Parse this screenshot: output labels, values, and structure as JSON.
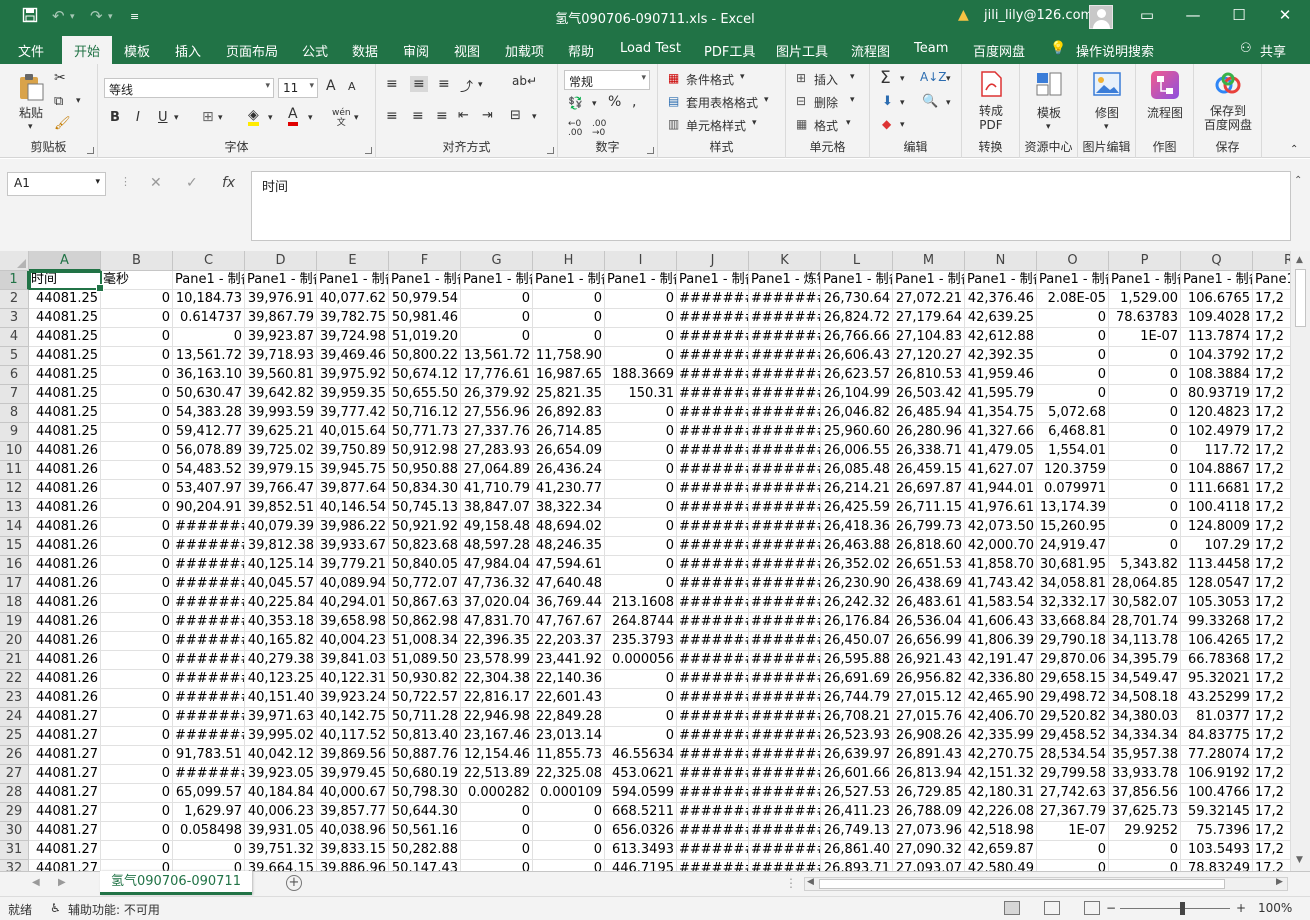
{
  "titlebar": {
    "title": "氢气090706-090711.xls  -  Excel",
    "user": "jili_lily@126.com"
  },
  "tabs": [
    "文件",
    "开始",
    "模板",
    "插入",
    "页面布局",
    "公式",
    "数据",
    "审阅",
    "视图",
    "加载项",
    "帮助",
    "Load Test",
    "PDF工具",
    "图片工具",
    "流程图",
    "Team",
    "百度网盘",
    "操作说明搜索",
    "共享"
  ],
  "ribbon": {
    "clipboard": {
      "paste": "粘贴",
      "label": "剪贴板"
    },
    "font": {
      "name": "等线",
      "size": "11",
      "grow": "A",
      "shrink": "A",
      "bold": "B",
      "italic": "I",
      "underline": "U",
      "wen": "wén",
      "label": "字体"
    },
    "align": {
      "label": "对齐方式"
    },
    "number": {
      "format": "常规",
      "percent": "%",
      "label": "数字"
    },
    "styles": {
      "cond": "条件格式",
      "table": "套用表格格式",
      "cell": "单元格样式",
      "label": "样式"
    },
    "cells": {
      "insert": "插入",
      "delete": "删除",
      "format": "格式",
      "label": "单元格"
    },
    "edit": {
      "label": "编辑"
    },
    "convert": {
      "btn1": "转成",
      "btn2": "PDF",
      "label": "转换"
    },
    "template": {
      "btn": "模板",
      "label": "资源中心"
    },
    "picture": {
      "btn": "修图",
      "label": "图片编辑"
    },
    "draw": {
      "btn": "流程图",
      "label": "作图"
    },
    "save": {
      "btn1": "保存到",
      "btn2": "百度网盘",
      "label": "保存"
    }
  },
  "formula": {
    "namebox": "A1",
    "fx": "fx",
    "content": "时间"
  },
  "columns": [
    "A",
    "B",
    "C",
    "D",
    "E",
    "F",
    "G",
    "H",
    "I",
    "J",
    "K",
    "L",
    "M",
    "N",
    "O",
    "P",
    "Q",
    "R"
  ],
  "rows": [
    [
      "时间",
      "毫秒",
      "Pane1 - 制备",
      "Pane1 - 制备",
      "Pane1 - 制备",
      "Pane1 - 制备",
      "Pane1 - 制备",
      "Pane1 - 制备",
      "Pane1 - 制备",
      "Pane1 - 制备",
      "Pane1 - 炼钢",
      "Pane1 - 制备",
      "Pane1 - 制备",
      "Pane1 - 制备",
      "Pane1 - 制备",
      "Pane1 - 制备",
      "Pane1 - 制备",
      "Pane1"
    ],
    [
      "44081.25",
      "0",
      "10,184.73",
      "39,976.91",
      "40,077.62",
      "50,979.54",
      "0",
      "0",
      "0",
      "#######",
      "#######",
      "26,730.64",
      "27,072.21",
      "42,376.46",
      "2.08E-05",
      "1,529.00",
      "106.6765",
      "17,2"
    ],
    [
      "44081.25",
      "0",
      "0.614737",
      "39,867.79",
      "39,782.75",
      "50,981.46",
      "0",
      "0",
      "0",
      "#######",
      "#######",
      "26,824.72",
      "27,179.64",
      "42,639.25",
      "0",
      "78.63783",
      "109.4028",
      "17,2"
    ],
    [
      "44081.25",
      "0",
      "0",
      "39,923.87",
      "39,724.98",
      "51,019.20",
      "0",
      "0",
      "0",
      "#######",
      "#######",
      "26,766.66",
      "27,104.83",
      "42,612.88",
      "0",
      "1E-07",
      "113.7874",
      "17,2"
    ],
    [
      "44081.25",
      "0",
      "13,561.72",
      "39,718.93",
      "39,469.46",
      "50,800.22",
      "13,561.72",
      "11,758.90",
      "0",
      "#######",
      "#######",
      "26,606.43",
      "27,120.27",
      "42,392.35",
      "0",
      "0",
      "104.3792",
      "17,2"
    ],
    [
      "44081.25",
      "0",
      "36,163.10",
      "39,560.81",
      "39,975.92",
      "50,674.12",
      "17,776.61",
      "16,987.65",
      "188.3669",
      "#######",
      "#######",
      "26,623.57",
      "26,810.53",
      "41,959.46",
      "0",
      "0",
      "108.3884",
      "17,2"
    ],
    [
      "44081.25",
      "0",
      "50,630.47",
      "39,642.82",
      "39,959.35",
      "50,655.50",
      "26,379.92",
      "25,821.35",
      "150.31",
      "#######",
      "#######",
      "26,104.99",
      "26,503.42",
      "41,595.79",
      "0",
      "0",
      "80.93719",
      "17,2"
    ],
    [
      "44081.25",
      "0",
      "54,383.28",
      "39,993.59",
      "39,777.42",
      "50,716.12",
      "27,556.96",
      "26,892.83",
      "0",
      "#######",
      "#######",
      "26,046.82",
      "26,485.94",
      "41,354.75",
      "5,072.68",
      "0",
      "120.4823",
      "17,2"
    ],
    [
      "44081.25",
      "0",
      "59,412.77",
      "39,625.21",
      "40,015.64",
      "50,771.73",
      "27,337.76",
      "26,714.85",
      "0",
      "#######",
      "#######",
      "25,960.60",
      "26,280.96",
      "41,327.66",
      "6,468.81",
      "0",
      "102.4979",
      "17,2"
    ],
    [
      "44081.26",
      "0",
      "56,078.89",
      "39,725.02",
      "39,750.89",
      "50,912.98",
      "27,283.93",
      "26,654.09",
      "0",
      "#######",
      "#######",
      "26,006.55",
      "26,338.71",
      "41,479.05",
      "1,554.01",
      "0",
      "117.72",
      "17,2"
    ],
    [
      "44081.26",
      "0",
      "54,483.52",
      "39,979.15",
      "39,945.75",
      "50,950.88",
      "27,064.89",
      "26,436.24",
      "0",
      "#######",
      "#######",
      "26,085.48",
      "26,459.15",
      "41,627.07",
      "120.3759",
      "0",
      "104.8867",
      "17,2"
    ],
    [
      "44081.26",
      "0",
      "53,407.97",
      "39,766.47",
      "39,877.64",
      "50,834.30",
      "41,710.79",
      "41,230.77",
      "0",
      "#######",
      "#######",
      "26,214.21",
      "26,697.87",
      "41,944.01",
      "0.079971",
      "0",
      "111.6681",
      "17,2"
    ],
    [
      "44081.26",
      "0",
      "90,204.91",
      "39,852.51",
      "40,146.54",
      "50,745.13",
      "38,847.07",
      "38,322.34",
      "0",
      "#######",
      "#######",
      "26,425.59",
      "26,711.15",
      "41,976.61",
      "13,174.39",
      "0",
      "100.4118",
      "17,2"
    ],
    [
      "44081.26",
      "0",
      "#######",
      "40,079.39",
      "39,986.22",
      "50,921.92",
      "49,158.48",
      "48,694.02",
      "0",
      "#######",
      "#######",
      "26,418.36",
      "26,799.73",
      "42,073.50",
      "15,260.95",
      "0",
      "124.8009",
      "17,2"
    ],
    [
      "44081.26",
      "0",
      "#######",
      "39,812.38",
      "39,933.67",
      "50,823.68",
      "48,597.28",
      "48,246.35",
      "0",
      "#######",
      "#######",
      "26,463.88",
      "26,818.60",
      "42,000.70",
      "24,919.47",
      "0",
      "107.29",
      "17,2"
    ],
    [
      "44081.26",
      "0",
      "#######",
      "40,125.14",
      "39,779.21",
      "50,840.05",
      "47,984.04",
      "47,594.61",
      "0",
      "#######",
      "#######",
      "26,352.02",
      "26,651.53",
      "41,858.70",
      "30,681.95",
      "5,343.82",
      "113.4458",
      "17,2"
    ],
    [
      "44081.26",
      "0",
      "#######",
      "40,045.57",
      "40,089.94",
      "50,772.07",
      "47,736.32",
      "47,640.48",
      "0",
      "#######",
      "#######",
      "26,230.90",
      "26,438.69",
      "41,743.42",
      "34,058.81",
      "28,064.85",
      "128.0547",
      "17,2"
    ],
    [
      "44081.26",
      "0",
      "#######",
      "40,225.84",
      "40,294.01",
      "50,867.63",
      "37,020.04",
      "36,769.44",
      "213.1608",
      "#######",
      "#######",
      "26,242.32",
      "26,483.61",
      "41,583.54",
      "32,332.17",
      "30,582.07",
      "105.3053",
      "17,2"
    ],
    [
      "44081.26",
      "0",
      "#######",
      "40,353.18",
      "39,658.98",
      "50,862.98",
      "47,831.70",
      "47,767.67",
      "264.8744",
      "#######",
      "#######",
      "26,176.84",
      "26,536.04",
      "41,606.43",
      "33,668.84",
      "28,701.74",
      "99.33268",
      "17,2"
    ],
    [
      "44081.26",
      "0",
      "#######",
      "40,165.82",
      "40,004.23",
      "51,008.34",
      "22,396.35",
      "22,203.37",
      "235.3793",
      "#######",
      "#######",
      "26,450.07",
      "26,656.99",
      "41,806.39",
      "29,790.18",
      "34,113.78",
      "106.4265",
      "17,2"
    ],
    [
      "44081.26",
      "0",
      "#######",
      "40,279.38",
      "39,841.03",
      "51,089.50",
      "23,578.99",
      "23,441.92",
      "0.000056",
      "#######",
      "#######",
      "26,595.88",
      "26,921.43",
      "42,191.47",
      "29,870.06",
      "34,395.79",
      "66.78368",
      "17,2"
    ],
    [
      "44081.26",
      "0",
      "#######",
      "40,123.25",
      "40,122.31",
      "50,930.82",
      "22,304.38",
      "22,140.36",
      "0",
      "#######",
      "#######",
      "26,691.69",
      "26,956.82",
      "42,336.80",
      "29,658.15",
      "34,549.47",
      "95.32021",
      "17,2"
    ],
    [
      "44081.26",
      "0",
      "#######",
      "40,151.40",
      "39,923.24",
      "50,722.57",
      "22,816.17",
      "22,601.43",
      "0",
      "#######",
      "#######",
      "26,744.79",
      "27,015.12",
      "42,465.90",
      "29,498.72",
      "34,508.18",
      "43.25299",
      "17,2"
    ],
    [
      "44081.27",
      "0",
      "#######",
      "39,971.63",
      "40,142.75",
      "50,711.28",
      "22,946.98",
      "22,849.28",
      "0",
      "#######",
      "#######",
      "26,708.21",
      "27,015.76",
      "42,406.70",
      "29,520.82",
      "34,380.03",
      "81.0377",
      "17,2"
    ],
    [
      "44081.27",
      "0",
      "#######",
      "39,995.02",
      "40,117.52",
      "50,813.40",
      "23,167.46",
      "23,013.14",
      "0",
      "#######",
      "#######",
      "26,523.93",
      "26,908.26",
      "42,335.99",
      "29,458.52",
      "34,334.34",
      "84.83775",
      "17,2"
    ],
    [
      "44081.27",
      "0",
      "91,783.51",
      "40,042.12",
      "39,869.56",
      "50,887.76",
      "12,154.46",
      "11,855.73",
      "46.55634",
      "#######",
      "#######",
      "26,639.97",
      "26,891.43",
      "42,270.75",
      "28,534.54",
      "35,957.38",
      "77.28074",
      "17,2"
    ],
    [
      "44081.27",
      "0",
      "#######",
      "39,923.05",
      "39,979.45",
      "50,680.19",
      "22,513.89",
      "22,325.08",
      "453.0621",
      "#######",
      "#######",
      "26,601.66",
      "26,813.94",
      "42,151.32",
      "29,799.58",
      "33,933.78",
      "106.9192",
      "17,2"
    ],
    [
      "44081.27",
      "0",
      "65,099.57",
      "40,184.84",
      "40,000.67",
      "50,798.30",
      "0.000282",
      "0.000109",
      "594.0599",
      "#######",
      "#######",
      "26,527.53",
      "26,729.85",
      "42,180.31",
      "27,742.63",
      "37,856.56",
      "100.4766",
      "17,2"
    ],
    [
      "44081.27",
      "0",
      "1,629.97",
      "40,006.23",
      "39,857.77",
      "50,644.30",
      "0",
      "0",
      "668.5211",
      "#######",
      "#######",
      "26,411.23",
      "26,788.09",
      "42,226.08",
      "27,367.79",
      "37,625.73",
      "59.32145",
      "17,2"
    ],
    [
      "44081.27",
      "0",
      "0.058498",
      "39,931.05",
      "40,038.96",
      "50,561.16",
      "0",
      "0",
      "656.0326",
      "#######",
      "#######",
      "26,749.13",
      "27,073.96",
      "42,518.98",
      "1E-07",
      "29.9252",
      "75.7396",
      "17,2"
    ],
    [
      "44081.27",
      "0",
      "0",
      "39,751.32",
      "39,833.15",
      "50,282.88",
      "0",
      "0",
      "613.3493",
      "#######",
      "#######",
      "26,861.40",
      "27,090.32",
      "42,659.87",
      "0",
      "0",
      "103.5493",
      "17,2"
    ],
    [
      "44081.27",
      "0",
      "0",
      "39,664.15",
      "39,886.96",
      "50,147.43",
      "0",
      "0",
      "446.7195",
      "#######",
      "#######",
      "26,893.71",
      "27,093.07",
      "42,580.49",
      "0",
      "0",
      "78.83249",
      "17,2"
    ]
  ],
  "sheet": {
    "name": "氢气090706-090711"
  },
  "status": {
    "ready": "就绪",
    "access": "辅助功能: 不可用",
    "zoom": "100%"
  }
}
